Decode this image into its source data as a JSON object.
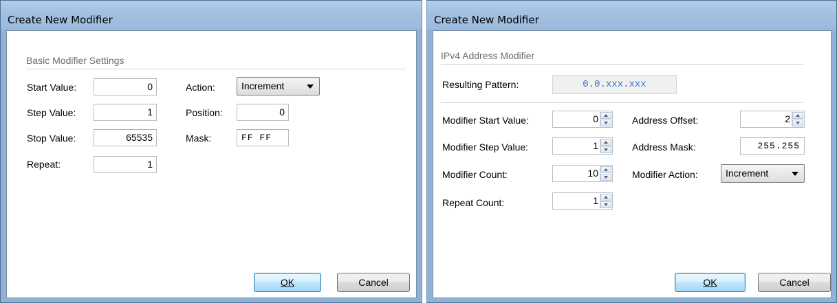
{
  "dialog1": {
    "title": "Create New Modifier",
    "group_title": "Basic Modifier Settings",
    "start_label": "Start Value:",
    "start_value": "0",
    "step_label": "Step Value:",
    "step_value": "1",
    "stop_label": "Stop Value:",
    "stop_value": "65535",
    "repeat_label": "Repeat:",
    "repeat_value": "1",
    "action_label": "Action:",
    "action_value": "Increment",
    "position_label": "Position:",
    "position_value": "0",
    "mask_label": "Mask:",
    "mask_value": "FF FF",
    "ok_label": "OK",
    "cancel_label": "Cancel"
  },
  "dialog2": {
    "title": "Create New Modifier",
    "group_title": "IPv4 Address Modifier",
    "pattern_label": "Resulting Pattern:",
    "pattern_value": "0.0.xxx.xxx",
    "mod_start_label": "Modifier Start Value:",
    "mod_start_value": "0",
    "mod_step_label": "Modifier Step Value:",
    "mod_step_value": "1",
    "mod_count_label": "Modifier Count:",
    "mod_count_value": "10",
    "repeat_count_label": "Repeat Count:",
    "repeat_count_value": "1",
    "addr_offset_label": "Address Offset:",
    "addr_offset_value": "2",
    "addr_mask_label": "Address Mask:",
    "addr_mask_value": "255.255",
    "mod_action_label": "Modifier Action:",
    "mod_action_value": "Increment",
    "ok_label": "OK",
    "cancel_label": "Cancel"
  },
  "colors": {
    "frame": "#8fb2d6",
    "titlebar": "#a3c0e1",
    "pattern_text": "#3973c7",
    "default_button": "#bee6fd"
  },
  "icons": {
    "dropdown": "chevron-down-icon",
    "spinner_up": "spin-up-icon",
    "spinner_down": "spin-down-icon"
  }
}
